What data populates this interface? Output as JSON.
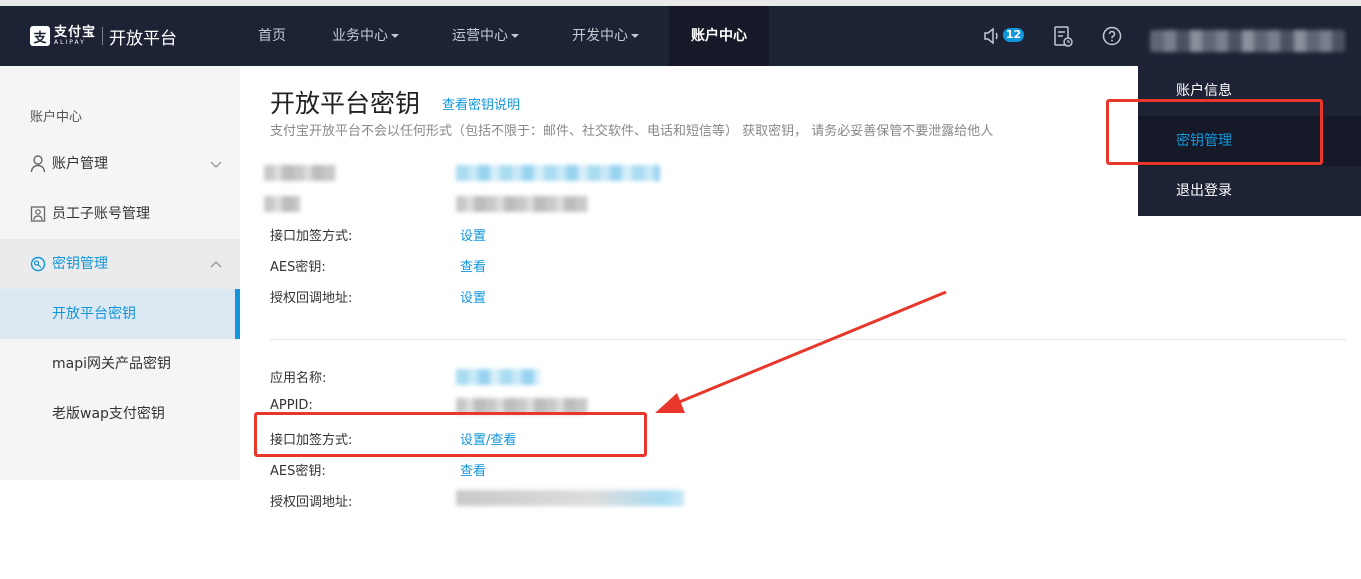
{
  "brand": {
    "logo_mark": "支",
    "logo_cn": "支付宝",
    "logo_en": "ALIPAY",
    "platform": "开放平台"
  },
  "nav": {
    "items": [
      "首页",
      "业务中心",
      "运营中心",
      "开发中心",
      "账户中心"
    ],
    "active": "账户中心"
  },
  "toolbar": {
    "notification_count": "12",
    "icons": [
      "speaker-icon",
      "document-clock-icon",
      "help-icon"
    ]
  },
  "sidebar": {
    "heading": "账户中心",
    "items": [
      {
        "label": "账户管理",
        "icon": "user-icon"
      },
      {
        "label": "员工子账号管理",
        "icon": "staff-icon"
      },
      {
        "label": "密钥管理",
        "icon": "key-icon"
      }
    ],
    "sub_items": [
      "开放平台密钥",
      "mapi网关产品密钥",
      "老版wap支付密钥"
    ]
  },
  "main": {
    "title": "开放平台密钥",
    "title_link": "查看密钥说明",
    "subtitle": "支付宝开放平台不会以任何形式（包括不限于：邮件、社交软件、电话和短信等） 获取密钥， 请务必妥善保管不要泄露给他人",
    "section1": [
      {
        "label": "接口加签方式:",
        "action": "设置"
      },
      {
        "label": "AES密钥:",
        "action": "查看"
      },
      {
        "label": "授权回调地址:",
        "action": "设置"
      }
    ],
    "section2": [
      {
        "label": "应用名称:"
      },
      {
        "label": "APPID:"
      },
      {
        "label": "接口加签方式:",
        "action": "设置/查看"
      },
      {
        "label": "AES密钥:",
        "action": "查看"
      },
      {
        "label": "授权回调地址:"
      }
    ]
  },
  "dropdown": {
    "items": [
      "账户信息",
      "密钥管理",
      "退出登录"
    ],
    "active": "密钥管理"
  },
  "colors": {
    "topbar": "#1d2235",
    "accent": "#1296db",
    "annotation": "#e8382c"
  }
}
